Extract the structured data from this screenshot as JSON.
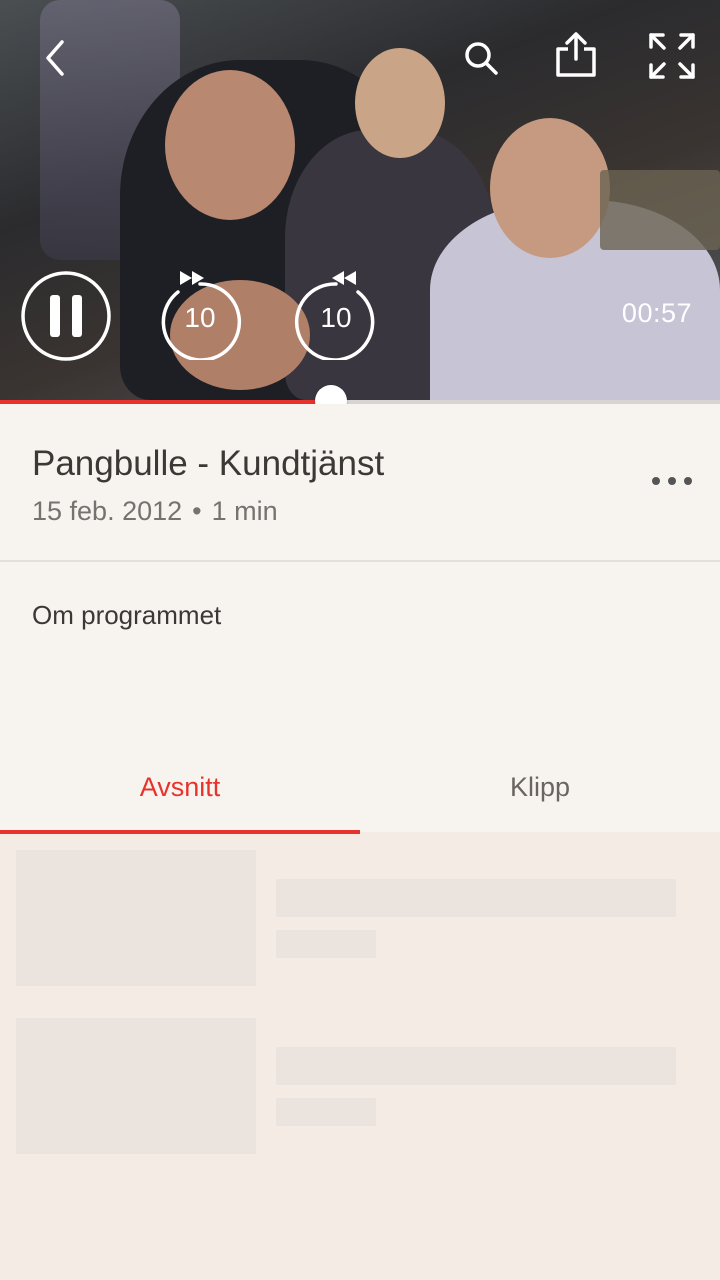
{
  "player": {
    "time_remaining": "00:57",
    "skip_back_seconds": "10",
    "skip_forward_seconds": "10",
    "progress": 0.46,
    "is_playing": true
  },
  "icons": {
    "back": "chevron-left-icon",
    "search": "search-icon",
    "share": "share-icon",
    "fullscreen": "fullscreen-icon",
    "pause": "pause-icon",
    "rewind": "rewind-10-icon",
    "forward": "forward-10-icon",
    "more": "more-horizontal-icon"
  },
  "program": {
    "title": "Pangbulle - Kundtjänst",
    "date": "15 feb. 2012",
    "separator": "•",
    "duration": "1 min"
  },
  "about": {
    "label": "Om programmet"
  },
  "tabs": [
    {
      "label": "Avsnitt",
      "active": true
    },
    {
      "label": "Klipp",
      "active": false
    }
  ],
  "colors": {
    "accent": "#e8332c",
    "background": "#f3ebe4",
    "info_background": "#f7f3ee",
    "placeholder": "#ebe3de"
  }
}
